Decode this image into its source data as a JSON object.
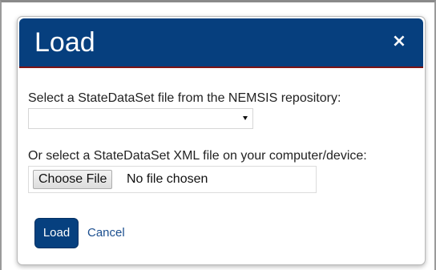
{
  "dialog": {
    "title": "Load",
    "close_label": "×"
  },
  "select_section": {
    "label": "Select a StateDataSet file from the NEMSIS repository:",
    "selected_value": ""
  },
  "file_section": {
    "label": "Or select a StateDataSet XML file on your computer/device:",
    "choose_button_label": "Choose File",
    "file_status": "No file chosen"
  },
  "footer": {
    "load_label": "Load",
    "cancel_label": "Cancel"
  },
  "colors": {
    "header_bg": "#063f7e",
    "header_border": "#7e1414",
    "primary_button": "#06407f",
    "link": "#1c4f8f"
  },
  "icons": {
    "close": "close-icon",
    "select_arrow": "caret-down-icon"
  }
}
